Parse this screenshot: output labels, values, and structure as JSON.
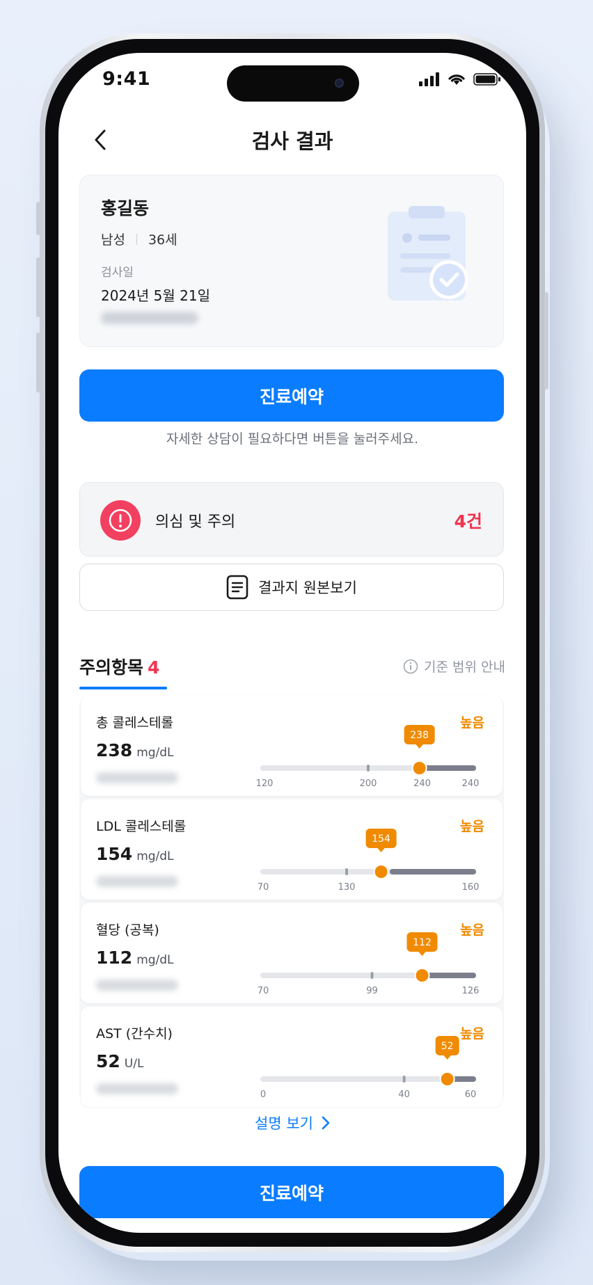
{
  "status_bar": {
    "time": "9:41"
  },
  "header": {
    "title": "검사 결과"
  },
  "patient": {
    "name": "홍길동",
    "gender": "남성",
    "age": "36세",
    "exam_date_label": "검사일",
    "exam_date": "2024년 5월 21일"
  },
  "primary_button_label": "진료예약",
  "hint": "자세한 상담이 필요하다면 버튼을 눌러주세요.",
  "alert": {
    "label": "의심 및 주의",
    "count": "4건"
  },
  "original_button_label": "결과지 원본보기",
  "section": {
    "title": "주의항목",
    "count": "4",
    "guide": "기준 범위 안내"
  },
  "items": [
    {
      "name": "총 콜레스테롤",
      "value": "238",
      "unit": "mg/dL",
      "status": "높음",
      "ticks": [
        "120",
        "200",
        "240",
        "240"
      ],
      "marker": "238",
      "gauge_min": 120,
      "gauge_max": 280,
      "threshold": 240,
      "mid": 200,
      "reading": 238
    },
    {
      "name": "LDL 콜레스테롤",
      "value": "154",
      "unit": "mg/dL",
      "status": "높음",
      "ticks": [
        "70",
        "130",
        "160"
      ],
      "marker": "154",
      "gauge_min": 70,
      "gauge_max": 220,
      "threshold": 160,
      "mid": 130,
      "reading": 154
    },
    {
      "name": "혈당 (공복)",
      "value": "112",
      "unit": "mg/dL",
      "status": "높음",
      "ticks": [
        "70",
        "99",
        "126"
      ],
      "marker": "112",
      "gauge_min": 70,
      "gauge_max": 126,
      "threshold": 126,
      "mid": 99,
      "reading": 112
    },
    {
      "name": "AST (간수치)",
      "value": "52",
      "unit": "U/L",
      "status": "높음",
      "ticks": [
        "0",
        "40",
        "60"
      ],
      "marker": "52",
      "gauge_min": 0,
      "gauge_max": 60,
      "threshold": 60,
      "mid": 40,
      "reading": 52
    }
  ],
  "see_more": "설명 보기",
  "bottom_button_label": "진료예약",
  "colors": {
    "primary": "#0a7cff",
    "danger": "#f0344f",
    "warning": "#f08a00"
  }
}
